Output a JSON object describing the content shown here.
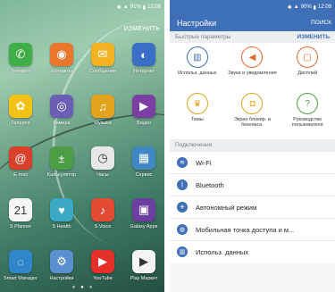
{
  "left": {
    "status": {
      "battery": "91%",
      "time": "12:09"
    },
    "edit_label": "ИЗМЕНИТЬ",
    "apps": [
      {
        "label": "Телефон",
        "icon": "phone-icon",
        "color": "#3fae49",
        "glyph": "✆"
      },
      {
        "label": "Контакты",
        "icon": "contacts-icon",
        "color": "#e9772b",
        "glyph": "◉"
      },
      {
        "label": "Сообщения",
        "icon": "messages-icon",
        "color": "#f3b321",
        "glyph": "✉"
      },
      {
        "label": "Интернет",
        "icon": "internet-icon",
        "color": "#3b6fc7",
        "glyph": "◐"
      },
      {
        "label": "Галерея",
        "icon": "gallery-icon",
        "color": "#f2c314",
        "glyph": "✿"
      },
      {
        "label": "Камера",
        "icon": "camera-icon",
        "color": "#6a5fb4",
        "glyph": "◎"
      },
      {
        "label": "Музыка",
        "icon": "music-icon",
        "color": "#e3a21c",
        "glyph": "♫"
      },
      {
        "label": "Видео",
        "icon": "video-icon",
        "color": "#7b3fa1",
        "glyph": "▶"
      },
      {
        "label": "E-mail",
        "icon": "email-icon",
        "color": "#d9402b",
        "glyph": "@"
      },
      {
        "label": "Калькулятор",
        "icon": "calculator-icon",
        "color": "#4d9c46",
        "glyph": "±"
      },
      {
        "label": "Часы",
        "icon": "clock-icon",
        "color": "#e8e8e8",
        "glyph": "◷"
      },
      {
        "label": "Сервис",
        "icon": "tools-icon",
        "color": "#3f88c5",
        "glyph": "▦"
      },
      {
        "label": "S Planner",
        "icon": "calendar-icon",
        "color": "#f5f5f5",
        "glyph": "21"
      },
      {
        "label": "S Health",
        "icon": "health-icon",
        "color": "#3aa9c4",
        "glyph": "♥"
      },
      {
        "label": "S Voice",
        "icon": "voice-icon",
        "color": "#e24a33",
        "glyph": "♪"
      },
      {
        "label": "Galaxy Apps",
        "icon": "galaxy-apps-icon",
        "color": "#6c3ea0",
        "glyph": "▣"
      },
      {
        "label": "Smart Manager",
        "icon": "smart-manager-icon",
        "color": "#2f86c9",
        "glyph": "◌"
      },
      {
        "label": "Настройки",
        "icon": "settings-icon",
        "color": "#5a8fd0",
        "glyph": "⚙"
      },
      {
        "label": "YouTube",
        "icon": "youtube-icon",
        "color": "#e5302a",
        "glyph": "▶"
      },
      {
        "label": "Play Маркет",
        "icon": "play-store-icon",
        "color": "#f4f4f4",
        "glyph": "▶"
      }
    ]
  },
  "right": {
    "status": {
      "battery": "90%",
      "time": "12:09"
    },
    "title": "Настройки",
    "search_label": "ПОИСК",
    "quick_header": "Быстрые параметры",
    "quick_action": "ИЗМЕНИТЬ",
    "quick": [
      {
        "label": "Использ. данных",
        "icon": "data-usage-icon",
        "color": "#3f6fb6",
        "glyph": "▥"
      },
      {
        "label": "Звуки и уведомления",
        "icon": "sound-icon",
        "color": "#e3692b",
        "glyph": "◀"
      },
      {
        "label": "Дисплей",
        "icon": "display-icon",
        "color": "#e3692b",
        "glyph": "▢"
      },
      {
        "label": "Темы",
        "icon": "themes-icon",
        "color": "#e3a21c",
        "glyph": "♛"
      },
      {
        "label": "Экран блокир. и безопасн.",
        "icon": "lock-icon",
        "color": "#e3a21c",
        "glyph": "◘"
      },
      {
        "label": "Руководство пользователя",
        "icon": "user-guide-icon",
        "color": "#4d9c46",
        "glyph": "?"
      }
    ],
    "conn_header": "Подключения",
    "connections": [
      {
        "label": "Wi-Fi",
        "icon": "wifi-icon",
        "glyph": "≋"
      },
      {
        "label": "Bluetooth",
        "icon": "bluetooth-icon",
        "glyph": "ᛒ"
      },
      {
        "label": "Автономный режим",
        "icon": "airplane-icon",
        "glyph": "✈"
      },
      {
        "label": "Мобильная точка доступа и м...",
        "icon": "hotspot-icon",
        "glyph": "◍"
      },
      {
        "label": "Использ. данных",
        "icon": "data-usage-icon",
        "glyph": "▥"
      }
    ]
  }
}
